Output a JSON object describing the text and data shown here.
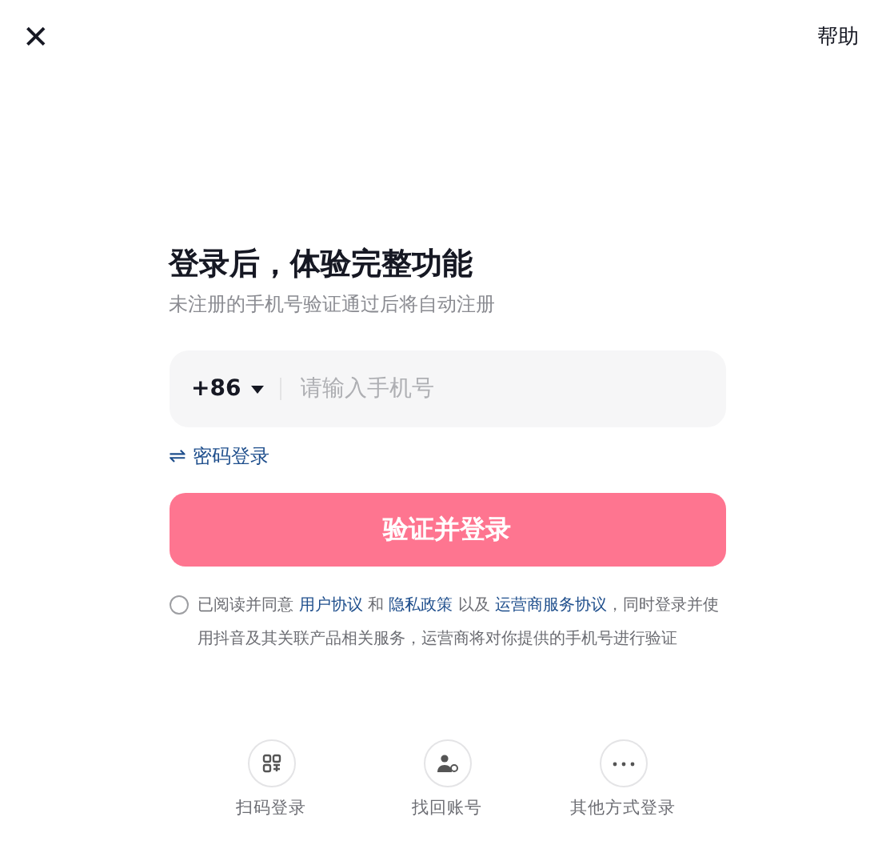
{
  "header": {
    "close": "✕",
    "help": "帮助"
  },
  "title": "登录后，体验完整功能",
  "subtitle": "未注册的手机号验证通过后将自动注册",
  "phone": {
    "country_code": "+86",
    "placeholder": "请输入手机号"
  },
  "password_login": {
    "icon": "⇌",
    "label": "密码登录"
  },
  "submit": "验证并登录",
  "agreement": {
    "checked": false,
    "segments": [
      {
        "kind": "text",
        "text": "已阅读并同意 "
      },
      {
        "kind": "link",
        "text": "用户协议"
      },
      {
        "kind": "text",
        "text": " 和 "
      },
      {
        "kind": "link",
        "text": "隐私政策"
      },
      {
        "kind": "text",
        "text": " 以及 "
      },
      {
        "kind": "link",
        "text": "运营商服务协议"
      },
      {
        "kind": "text",
        "text": "，同时登录并使用抖音及其关联产品相关服务，运营商将对你提供的手机号进行验证"
      }
    ]
  },
  "other_options": [
    {
      "kind": "scan",
      "label": "扫码登录"
    },
    {
      "kind": "recover",
      "label": "找回账号"
    },
    {
      "kind": "more",
      "label": "其他方式登录"
    }
  ]
}
